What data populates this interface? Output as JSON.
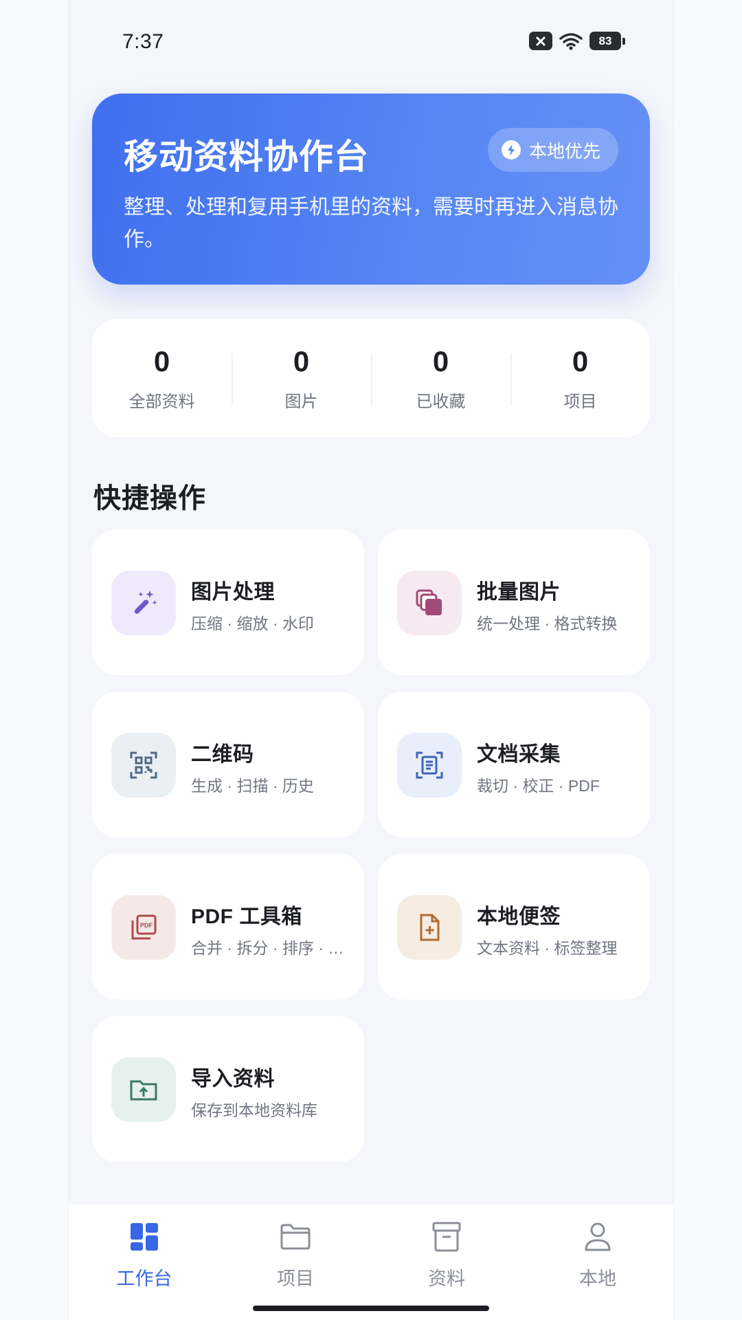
{
  "status_bar": {
    "time": "7:37",
    "battery": "83"
  },
  "hero": {
    "title": "移动资料协作台",
    "badge": "本地优先",
    "description": "整理、处理和复用手机里的资料，需要时再进入消息协作。"
  },
  "stats": [
    {
      "value": "0",
      "label": "全部资料"
    },
    {
      "value": "0",
      "label": "图片"
    },
    {
      "value": "0",
      "label": "已收藏"
    },
    {
      "value": "0",
      "label": "项目"
    }
  ],
  "quick_actions": {
    "title": "快捷操作",
    "items": [
      {
        "title": "图片处理",
        "subtitle": "压缩 · 缩放 · 水印",
        "icon": "magic-wand-icon"
      },
      {
        "title": "批量图片",
        "subtitle": "统一处理 · 格式转换",
        "icon": "layers-icon"
      },
      {
        "title": "二维码",
        "subtitle": "生成 · 扫描 · 历史",
        "icon": "qr-code-icon"
      },
      {
        "title": "文档采集",
        "subtitle": "裁切 · 校正 · PDF",
        "icon": "document-scan-icon"
      },
      {
        "title": "PDF 工具箱",
        "subtitle": "合并 · 拆分 · 排序 · …",
        "icon": "pdf-icon"
      },
      {
        "title": "本地便签",
        "subtitle": "文本资料 · 标签整理",
        "icon": "note-add-icon"
      },
      {
        "title": "导入资料",
        "subtitle": "保存到本地资料库",
        "icon": "folder-upload-icon"
      }
    ]
  },
  "bottom_nav": [
    {
      "label": "工作台",
      "icon": "dashboard-icon",
      "active": true
    },
    {
      "label": "项目",
      "icon": "folder-icon",
      "active": false
    },
    {
      "label": "资料",
      "icon": "archive-icon",
      "active": false
    },
    {
      "label": "本地",
      "icon": "person-icon",
      "active": false
    }
  ],
  "colors": {
    "accent": "#3766e6",
    "hero_gradient_start": "#3f6fee",
    "hero_gradient_end": "#6590f5"
  }
}
